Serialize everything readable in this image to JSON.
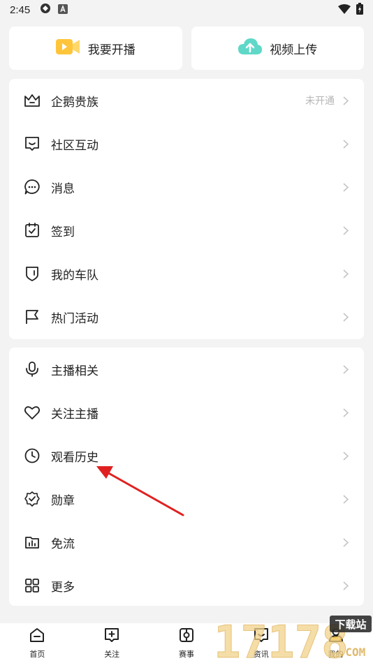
{
  "status_bar": {
    "time": "2:45"
  },
  "quick_actions": [
    {
      "label": "我要开播",
      "icon": "video-camera-icon"
    },
    {
      "label": "视频上传",
      "icon": "cloud-upload-icon"
    }
  ],
  "menu_group_1": [
    {
      "label": "企鹅贵族",
      "icon": "crown-icon",
      "extra": "未开通"
    },
    {
      "label": "社区互动",
      "icon": "chat-square-icon"
    },
    {
      "label": "消息",
      "icon": "message-bubble-icon"
    },
    {
      "label": "签到",
      "icon": "calendar-check-icon"
    },
    {
      "label": "我的车队",
      "icon": "shield-icon"
    },
    {
      "label": "热门活动",
      "icon": "flag-icon"
    }
  ],
  "menu_group_2": [
    {
      "label": "主播相关",
      "icon": "microphone-icon"
    },
    {
      "label": "关注主播",
      "icon": "heart-icon"
    },
    {
      "label": "观看历史",
      "icon": "clock-icon"
    },
    {
      "label": "勋章",
      "icon": "badge-icon"
    },
    {
      "label": "免流",
      "icon": "data-chart-icon"
    },
    {
      "label": "更多",
      "icon": "grid-icon"
    }
  ],
  "bottom_nav": [
    {
      "label": "首页",
      "icon": "home-icon"
    },
    {
      "label": "关注",
      "icon": "follow-icon"
    },
    {
      "label": "赛事",
      "icon": "match-icon"
    },
    {
      "label": "资讯",
      "icon": "news-icon"
    },
    {
      "label": "我的",
      "icon": "profile-icon",
      "active": true
    }
  ],
  "watermark": {
    "text": "17178",
    "badge": "下载站",
    "suffix": ".COM"
  },
  "colors": {
    "accent_yellow": "#ffc53a",
    "upload_teal": "#5fd8c8",
    "annotation_red": "#e02020",
    "text": "#222222",
    "muted": "#b5b5b5"
  }
}
